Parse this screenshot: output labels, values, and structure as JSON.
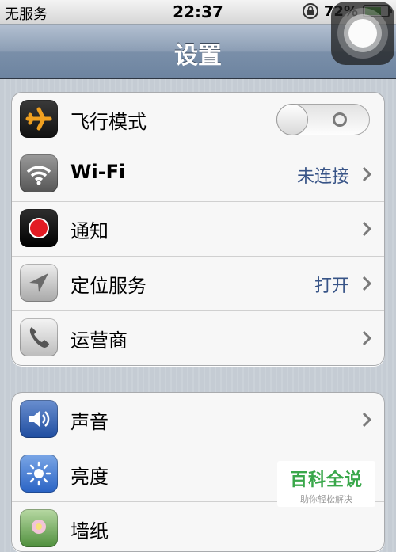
{
  "status_bar": {
    "carrier": "无服务",
    "time": "22:37",
    "battery_percent": "72",
    "battery_level": 0.72
  },
  "nav": {
    "title": "设置"
  },
  "group1": [
    {
      "label": "飞行模式",
      "icon": "airplane-icon",
      "control": "toggle",
      "toggle_on": false
    },
    {
      "label": "Wi-Fi",
      "icon": "wifi-icon",
      "value": "未连接"
    },
    {
      "label": "通知",
      "icon": "notification-icon",
      "value": ""
    },
    {
      "label": "定位服务",
      "icon": "location-icon",
      "value": "打开"
    },
    {
      "label": "运营商",
      "icon": "phone-icon",
      "value": ""
    }
  ],
  "group2": [
    {
      "label": "声音",
      "icon": "speaker-icon"
    },
    {
      "label": "亮度",
      "icon": "brightness-icon"
    },
    {
      "label": "墙纸",
      "icon": "wallpaper-icon"
    }
  ],
  "watermark": {
    "title": "百科全说",
    "subtitle": "助你轻松解决"
  },
  "colors": {
    "value_text": "#385487",
    "nav_bar": "#7a8fa9",
    "background": "#c5ccd4"
  }
}
